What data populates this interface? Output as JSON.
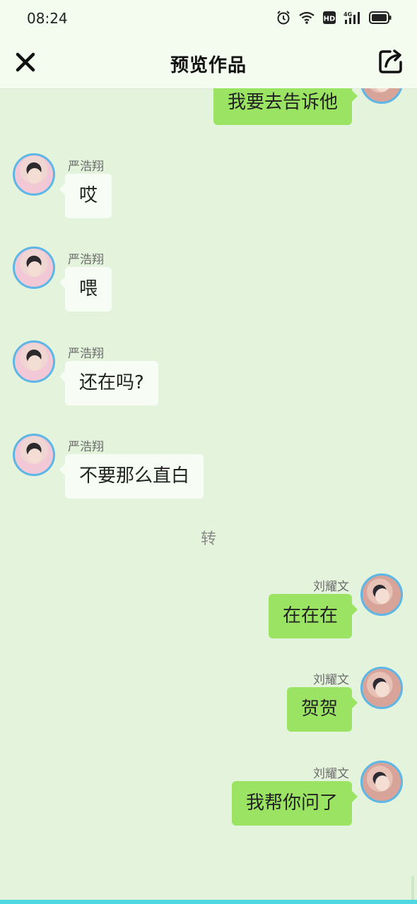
{
  "status_bar": {
    "time": "08:24",
    "icons": [
      "alarm-icon",
      "wifi-icon",
      "hd-icon",
      "4g-signal-icon",
      "battery-icon"
    ]
  },
  "header": {
    "title": "预览作品",
    "close_icon": "close-icon",
    "share_icon": "share-icon"
  },
  "chat": {
    "messages": [
      {
        "side": "right",
        "sender": "",
        "text": "我要去告诉他"
      },
      {
        "side": "left",
        "sender": "严浩翔",
        "text": "哎"
      },
      {
        "side": "left",
        "sender": "严浩翔",
        "text": "喂"
      },
      {
        "side": "left",
        "sender": "严浩翔",
        "text": "还在吗?"
      },
      {
        "side": "left",
        "sender": "严浩翔",
        "text": "不要那么直白"
      },
      {
        "side": "center",
        "sender": "",
        "text": "转"
      },
      {
        "side": "right",
        "sender": "刘耀文",
        "text": "在在在"
      },
      {
        "side": "right",
        "sender": "刘耀文",
        "text": "贺贺"
      },
      {
        "side": "right",
        "sender": "刘耀文",
        "text": "我帮你问了"
      }
    ]
  },
  "colors": {
    "background": "#e4f4dc",
    "outgoing_bubble": "#9ae363",
    "incoming_bubble": "#f7fdf4",
    "avatar_border": "#5cb6e6"
  }
}
